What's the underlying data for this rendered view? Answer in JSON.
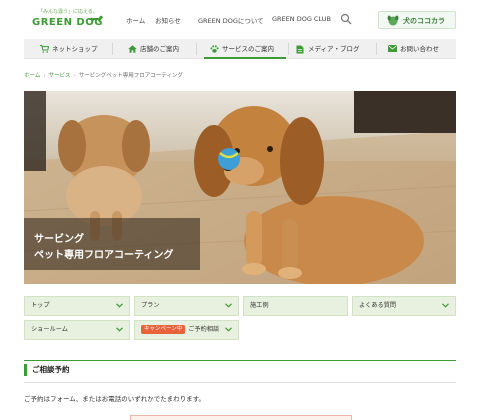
{
  "header": {
    "logo_tagline": "「みんな違う」に応える。",
    "logo_text": "GREEN DOG",
    "nav": [
      "ホーム",
      "お知らせ",
      "GREEN DOGについて",
      "GREEN DOG CLUB"
    ],
    "kokokara_label": "犬のココカラ"
  },
  "main_nav": [
    {
      "label": "ネットショップ",
      "icon": "cart-icon"
    },
    {
      "label": "店舗のご案内",
      "icon": "home-icon"
    },
    {
      "label": "サービスのご案内",
      "icon": "paw-icon",
      "active": true
    },
    {
      "label": "メディア・ブログ",
      "icon": "document-icon"
    },
    {
      "label": "お問い合わせ",
      "icon": "mail-icon"
    }
  ],
  "breadcrumb": [
    "ホーム",
    "サービス",
    "サービングペット専用フロアコーティング"
  ],
  "hero": {
    "caption_line1": "サービング",
    "caption_line2": "ペット専用フロアコーティング"
  },
  "sub_nav": [
    {
      "label": "トップ",
      "chevron": true
    },
    {
      "label": "プラン",
      "chevron": true
    },
    {
      "label": "施工例",
      "chevron": false
    },
    {
      "label": "よくある質問",
      "chevron": true
    },
    {
      "label": "ショールーム",
      "chevron": true
    },
    {
      "label": "ご予約相談",
      "badge": "キャンペーン中",
      "chevron": true
    }
  ],
  "section": {
    "heading": "ご相談予約",
    "text": "ご予約はフォーム、またはお電話のいずれかでたまわります。"
  },
  "colors": {
    "brand_green": "#3d9b35",
    "subnav_bg": "#e8f1df",
    "campaign": "#e8623a"
  }
}
